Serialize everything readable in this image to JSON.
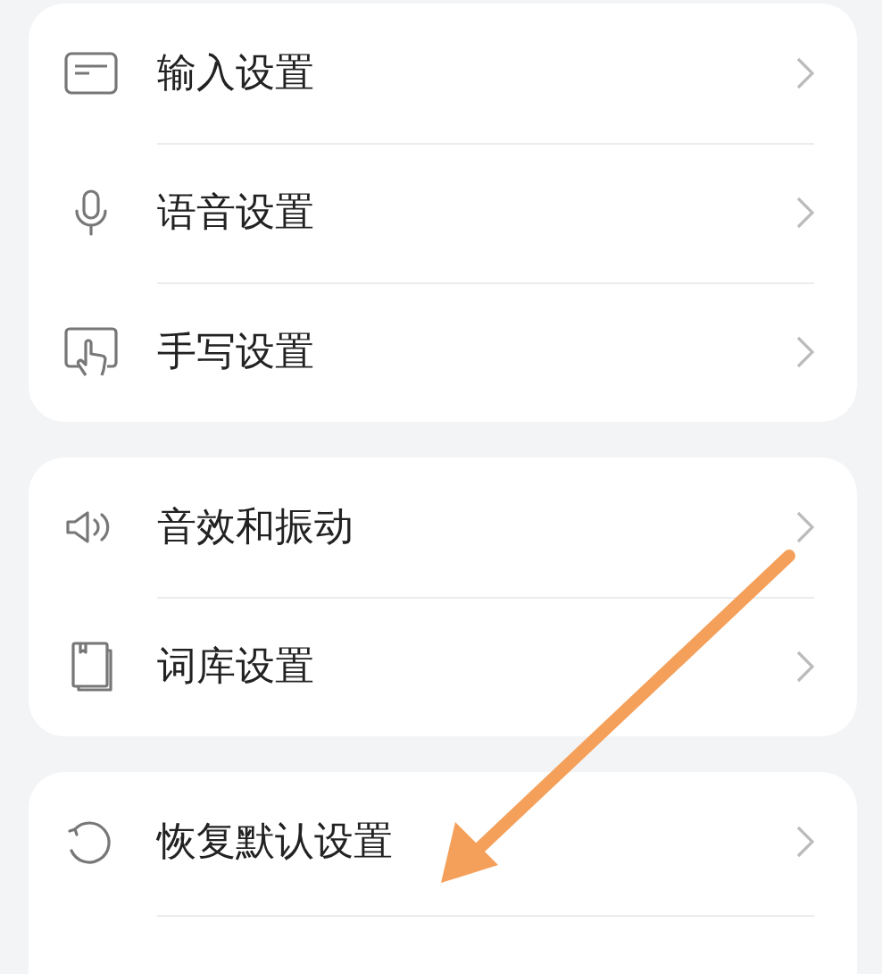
{
  "groups": [
    {
      "items": [
        {
          "label": "输入设置"
        },
        {
          "label": "语音设置"
        },
        {
          "label": "手写设置"
        }
      ]
    },
    {
      "items": [
        {
          "label": "音效和振动"
        },
        {
          "label": "词库设置"
        }
      ]
    },
    {
      "items": [
        {
          "label": "恢复默认设置"
        }
      ]
    }
  ],
  "annotation": {
    "kind": "arrow"
  }
}
